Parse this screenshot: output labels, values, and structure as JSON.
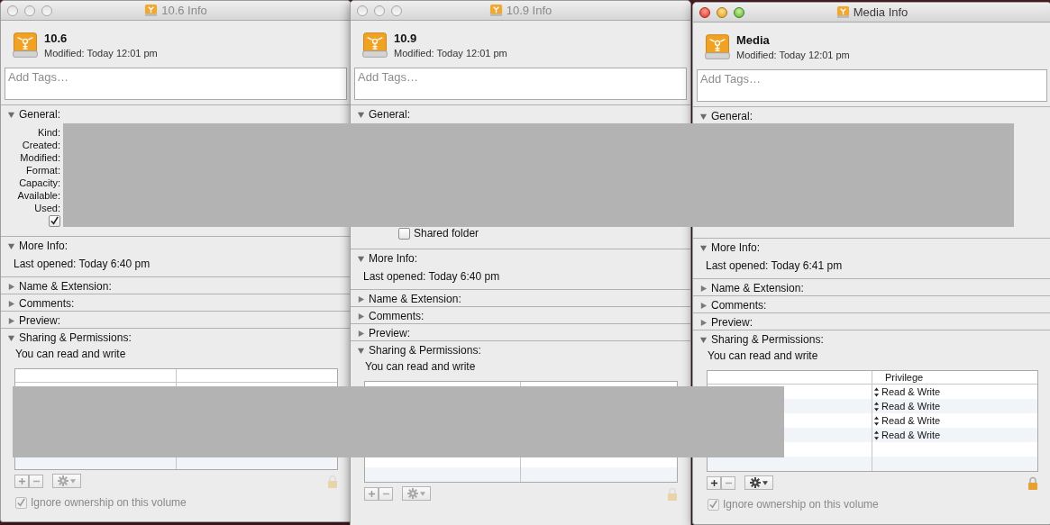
{
  "windows": [
    {
      "title": "10.6 Info",
      "active": false,
      "name": "10.6",
      "modified": "Modified: Today 12:01 pm",
      "tags_placeholder": "Add Tags…",
      "sections": [
        {
          "kind": "general",
          "label": "General:",
          "expanded": true,
          "fields": [
            "Kind:",
            "Created:",
            "Modified:",
            "Format:",
            "Capacity:",
            "Available:",
            "Used:"
          ],
          "checkbox": {
            "checked": true
          }
        },
        {
          "kind": "info",
          "label": "More Info:",
          "expanded": true,
          "text": "Last opened: Today 6:40 pm"
        },
        {
          "kind": "plain",
          "label": "Name & Extension:",
          "expanded": false
        },
        {
          "kind": "plain",
          "label": "Comments:",
          "expanded": false
        },
        {
          "kind": "plain",
          "label": "Preview:",
          "expanded": false
        },
        {
          "kind": "sharing",
          "label": "Sharing & Permissions:",
          "expanded": true,
          "text": "You can read and write",
          "locked": true,
          "ignore_ownership": {
            "label": "Ignore ownership on this volume",
            "checked": true,
            "disabled": true
          }
        }
      ]
    },
    {
      "title": "10.9 Info",
      "active": false,
      "name": "10.9",
      "modified": "Modified: Today 12:01 pm",
      "tags_placeholder": "Add Tags…",
      "sections": [
        {
          "kind": "general",
          "label": "General:",
          "expanded": true,
          "checkbox": {
            "label": "Shared folder",
            "checked": false
          }
        },
        {
          "kind": "info",
          "label": "More Info:",
          "expanded": true,
          "text": "Last opened: Today 6:40 pm"
        },
        {
          "kind": "plain",
          "label": "Name & Extension:",
          "expanded": false
        },
        {
          "kind": "plain",
          "label": "Comments:",
          "expanded": false
        },
        {
          "kind": "plain",
          "label": "Preview:",
          "expanded": false
        },
        {
          "kind": "sharing",
          "label": "Sharing & Permissions:",
          "expanded": true,
          "text": "You can read and write",
          "locked": true
        }
      ]
    },
    {
      "title": "Media Info",
      "active": true,
      "name": "Media",
      "modified": "Modified: Today 12:01 pm",
      "tags_placeholder": "Add Tags…",
      "sections": [
        {
          "kind": "general",
          "label": "General:",
          "expanded": true
        },
        {
          "kind": "info",
          "label": "More Info:",
          "expanded": true,
          "text": "Last opened: Today 6:41 pm"
        },
        {
          "kind": "plain",
          "label": "Name & Extension:",
          "expanded": false
        },
        {
          "kind": "plain",
          "label": "Comments:",
          "expanded": false
        },
        {
          "kind": "plain",
          "label": "Preview:",
          "expanded": false
        },
        {
          "kind": "sharing",
          "label": "Sharing & Permissions:",
          "expanded": true,
          "text": "You can read and write",
          "privilege_header": "Privilege",
          "rows": [
            {
              "privilege": "Read & Write"
            },
            {
              "privilege": "Read & Write"
            },
            {
              "privilege": "Read & Write"
            },
            {
              "privilege": "Read & Write"
            }
          ],
          "locked": true,
          "ignore_ownership": {
            "label": "Ignore ownership on this volume",
            "checked": true,
            "disabled": true
          }
        }
      ]
    }
  ]
}
